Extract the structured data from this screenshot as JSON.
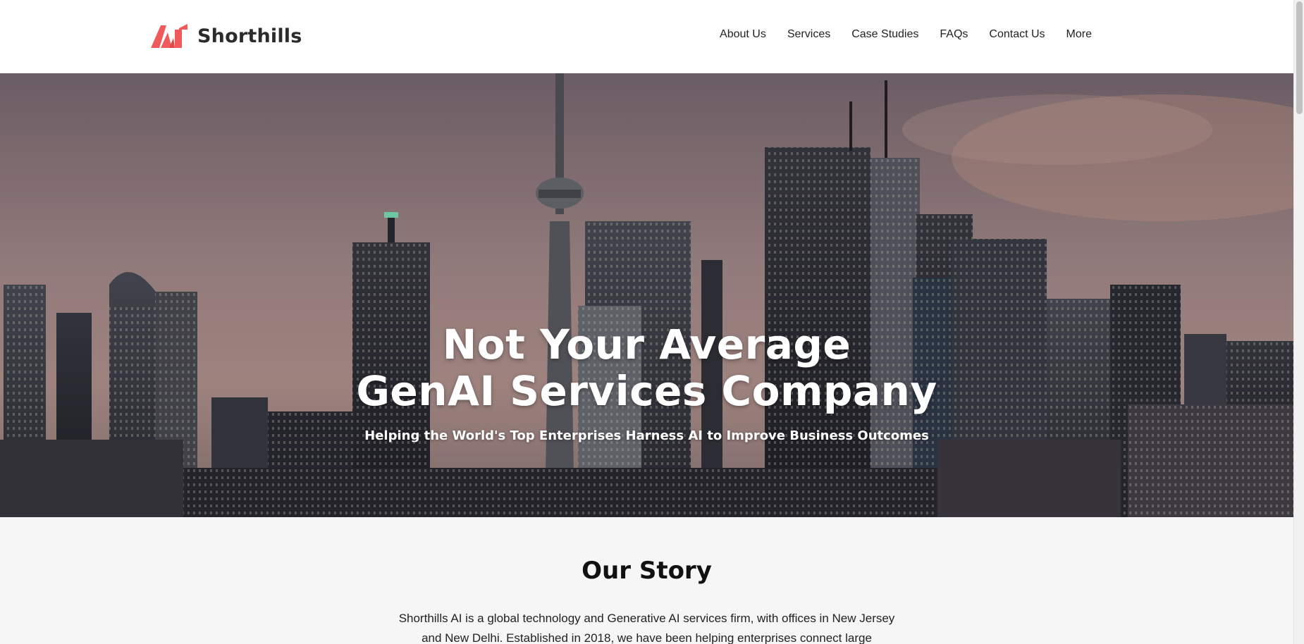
{
  "header": {
    "brand_name": "Shorthills",
    "brand_color": "#f15a5a",
    "nav": [
      {
        "label": "About Us"
      },
      {
        "label": "Services"
      },
      {
        "label": "Case Studies"
      },
      {
        "label": "FAQs"
      },
      {
        "label": "Contact Us"
      },
      {
        "label": "More"
      }
    ]
  },
  "hero": {
    "title_line1": "Not Your Average",
    "title_line2": "GenAI Services Company",
    "subtitle": "Helping the World's Top Enterprises Harness AI to Improve Business Outcomes",
    "image_description_icon": "city-skyline-image"
  },
  "story": {
    "title": "Our Story",
    "body": "Shorthills AI is a global technology and Generative AI services firm, with offices in New Jersey and New Delhi. Established in 2018, we have been helping enterprises connect large"
  }
}
